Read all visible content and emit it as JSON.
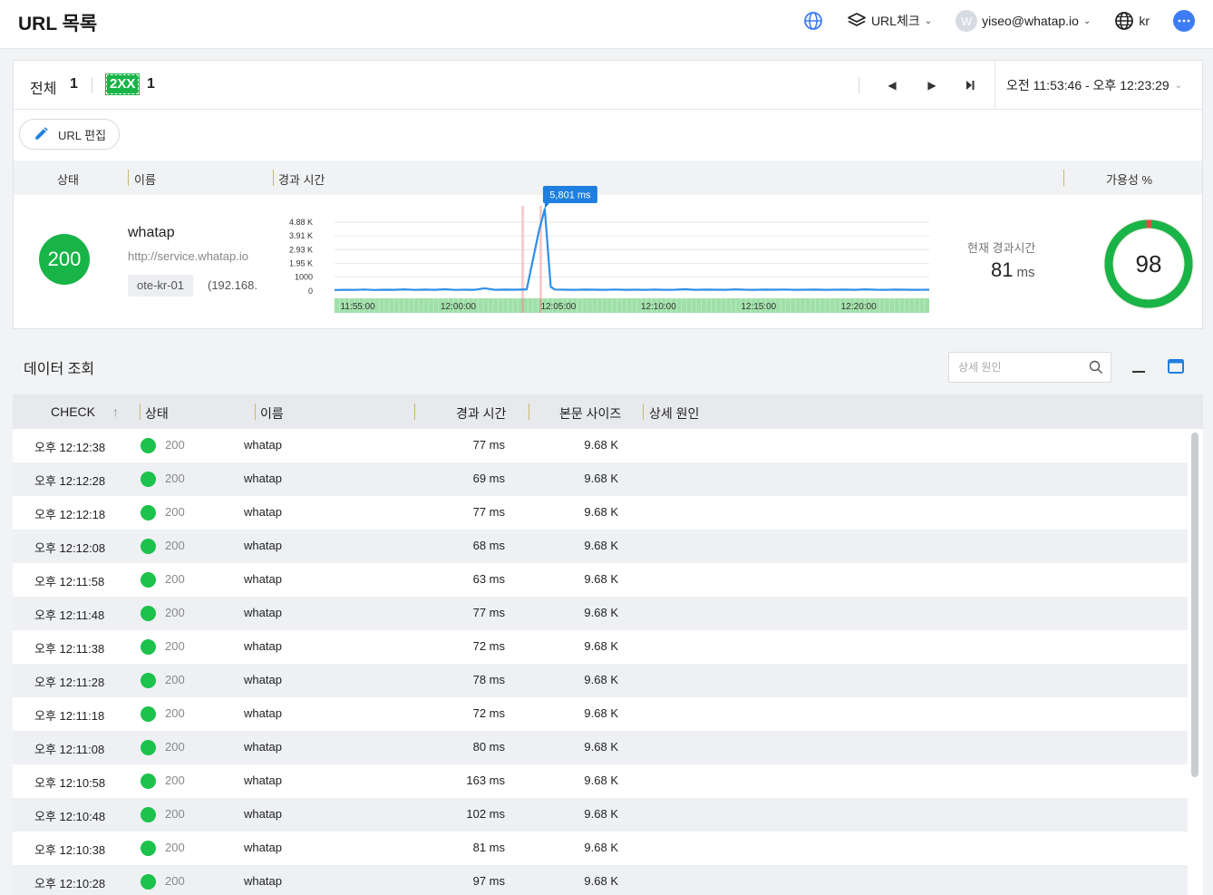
{
  "header": {
    "title": "URL 목록",
    "product_label": "URL체크",
    "user_initial": "W",
    "user_email": "yiseo@whatap.io",
    "language": "kr"
  },
  "filter": {
    "total_label": "전체",
    "total_count": "1",
    "chip_label": "2XX",
    "chip_count": "1",
    "time_range": "오전 11:53:46 - 오후 12:23:29"
  },
  "toolbar": {
    "edit_label": "URL 편집"
  },
  "url_table": {
    "headers": {
      "status": "상태",
      "name": "이름",
      "elapsed": "경과 시간",
      "availability": "가용성 %"
    },
    "row": {
      "status_code": "200",
      "name": "whatap",
      "url": "http://service.whatap.io",
      "location": "ote-kr-01",
      "ip": "(192.168.",
      "current_label": "현재 경과시간",
      "current_value": "81",
      "current_unit": "ms",
      "availability": "98",
      "availability_fraction": 0.98
    }
  },
  "chart_data": {
    "type": "line",
    "y_tick_labels": [
      "4.88 K",
      "3.91 K",
      "2.93 K",
      "1.95 K",
      "1000",
      "0"
    ],
    "x_tick_labels": [
      "11:55:00",
      "12:00:00",
      "12:05:00",
      "12:10:00",
      "12:15:00",
      "12:20:00"
    ],
    "peak_label": "5,801 ms",
    "ylim": [
      0,
      5000
    ],
    "colors": {
      "line": "#2f8fe6",
      "status_bar": "#9fdfa8",
      "error_mark": "#f4b8b8",
      "peak": "#1f7fe0"
    },
    "series": [
      {
        "values": [
          [
            0.0,
            80
          ],
          [
            0.5,
            90
          ],
          [
            1.0,
            85
          ],
          [
            1.5,
            110
          ],
          [
            2.0,
            80
          ],
          [
            2.5,
            95
          ],
          [
            3.0,
            90
          ],
          [
            3.5,
            120
          ],
          [
            4.0,
            85
          ],
          [
            4.5,
            100
          ],
          [
            5.0,
            90
          ],
          [
            5.5,
            130
          ],
          [
            6.0,
            85
          ],
          [
            6.5,
            95
          ],
          [
            7.0,
            90
          ],
          [
            7.5,
            200
          ],
          [
            8.0,
            90
          ],
          [
            8.5,
            100
          ],
          [
            9.0,
            95
          ],
          [
            9.6,
            120
          ],
          [
            10.2,
            4200
          ],
          [
            10.5,
            5801
          ],
          [
            10.8,
            300
          ],
          [
            11.0,
            110
          ],
          [
            11.5,
            95
          ],
          [
            12.0,
            90
          ],
          [
            12.5,
            100
          ],
          [
            13.0,
            95
          ],
          [
            13.5,
            90
          ],
          [
            14.0,
            110
          ],
          [
            14.5,
            90
          ],
          [
            15.0,
            95
          ],
          [
            15.5,
            90
          ],
          [
            16.0,
            100
          ],
          [
            16.5,
            90
          ],
          [
            17.0,
            95
          ],
          [
            17.5,
            130
          ],
          [
            18.0,
            90
          ],
          [
            18.5,
            100
          ],
          [
            19.0,
            95
          ],
          [
            19.5,
            90
          ],
          [
            20.0,
            120
          ],
          [
            20.5,
            95
          ],
          [
            21.0,
            90
          ],
          [
            21.5,
            100
          ],
          [
            22.0,
            95
          ],
          [
            22.5,
            110
          ],
          [
            23.0,
            90
          ],
          [
            23.5,
            95
          ],
          [
            24.0,
            100
          ],
          [
            24.5,
            90
          ],
          [
            25.0,
            95
          ],
          [
            25.5,
            100
          ],
          [
            26.0,
            90
          ],
          [
            26.5,
            120
          ],
          [
            27.0,
            95
          ],
          [
            27.5,
            90
          ],
          [
            28.0,
            100
          ],
          [
            28.5,
            95
          ],
          [
            29.0,
            90
          ],
          [
            29.7,
            95
          ]
        ]
      }
    ]
  },
  "data_view": {
    "title": "데이터 조회",
    "search_placeholder": "상세 원인",
    "headers": {
      "check": "CHECK",
      "sort_arrow": "↑",
      "status": "상태",
      "name": "이름",
      "elapsed": "경과 시간",
      "size": "본문 사이즈",
      "cause": "상세 원인"
    },
    "rows": [
      {
        "time": "오후 12:12:38",
        "code": "200",
        "name": "whatap",
        "elapsed": "77 ms",
        "size": "9.68 K"
      },
      {
        "time": "오후 12:12:28",
        "code": "200",
        "name": "whatap",
        "elapsed": "69 ms",
        "size": "9.68 K"
      },
      {
        "time": "오후 12:12:18",
        "code": "200",
        "name": "whatap",
        "elapsed": "77 ms",
        "size": "9.68 K"
      },
      {
        "time": "오후 12:12:08",
        "code": "200",
        "name": "whatap",
        "elapsed": "68 ms",
        "size": "9.68 K"
      },
      {
        "time": "오후 12:11:58",
        "code": "200",
        "name": "whatap",
        "elapsed": "63 ms",
        "size": "9.68 K"
      },
      {
        "time": "오후 12:11:48",
        "code": "200",
        "name": "whatap",
        "elapsed": "77 ms",
        "size": "9.68 K"
      },
      {
        "time": "오후 12:11:38",
        "code": "200",
        "name": "whatap",
        "elapsed": "72 ms",
        "size": "9.68 K"
      },
      {
        "time": "오후 12:11:28",
        "code": "200",
        "name": "whatap",
        "elapsed": "78 ms",
        "size": "9.68 K"
      },
      {
        "time": "오후 12:11:18",
        "code": "200",
        "name": "whatap",
        "elapsed": "72 ms",
        "size": "9.68 K"
      },
      {
        "time": "오후 12:11:08",
        "code": "200",
        "name": "whatap",
        "elapsed": "80 ms",
        "size": "9.68 K"
      },
      {
        "time": "오후 12:10:58",
        "code": "200",
        "name": "whatap",
        "elapsed": "163 ms",
        "size": "9.68 K"
      },
      {
        "time": "오후 12:10:48",
        "code": "200",
        "name": "whatap",
        "elapsed": "102 ms",
        "size": "9.68 K"
      },
      {
        "time": "오후 12:10:38",
        "code": "200",
        "name": "whatap",
        "elapsed": "81 ms",
        "size": "9.68 K"
      },
      {
        "time": "오후 12:10:28",
        "code": "200",
        "name": "whatap",
        "elapsed": "97 ms",
        "size": "9.68 K"
      }
    ]
  }
}
